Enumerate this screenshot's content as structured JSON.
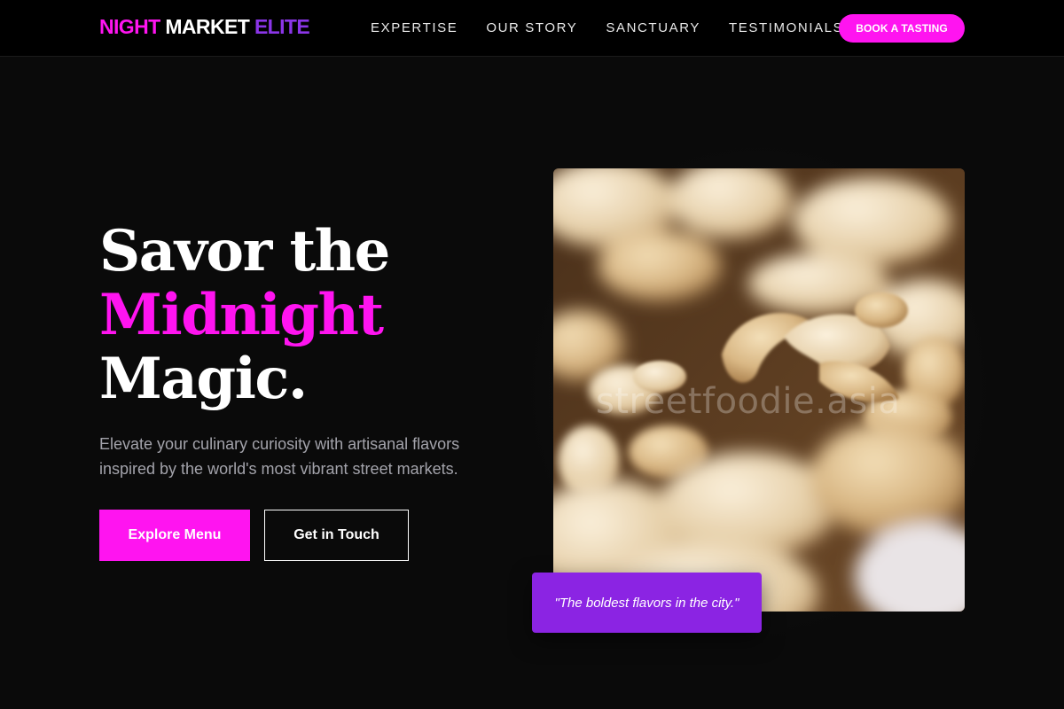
{
  "brand": {
    "part1": "NIGHT",
    "part2": "MARKET",
    "part3": "ELITE"
  },
  "nav": {
    "links": [
      "EXPERTISE",
      "OUR STORY",
      "SANCTUARY",
      "TESTIMONIALS"
    ],
    "cta": "BOOK A TASTING"
  },
  "hero": {
    "title_line1": "Savor the",
    "title_line2": "Midnight",
    "title_line3": "Magic.",
    "subtitle": "Elevate your culinary curiosity with artisanal flavors inspired by the world's most vibrant street markets.",
    "primary_button": "Explore Menu",
    "secondary_button": "Get in Touch"
  },
  "photo": {
    "watermark": "streetfoodie.asia"
  },
  "quote": "\"The boldest flavors in the city.\"",
  "colors": {
    "accent_pink": "#ff14f0",
    "accent_purple": "#8b24e3",
    "background": "#0a0a0a"
  }
}
